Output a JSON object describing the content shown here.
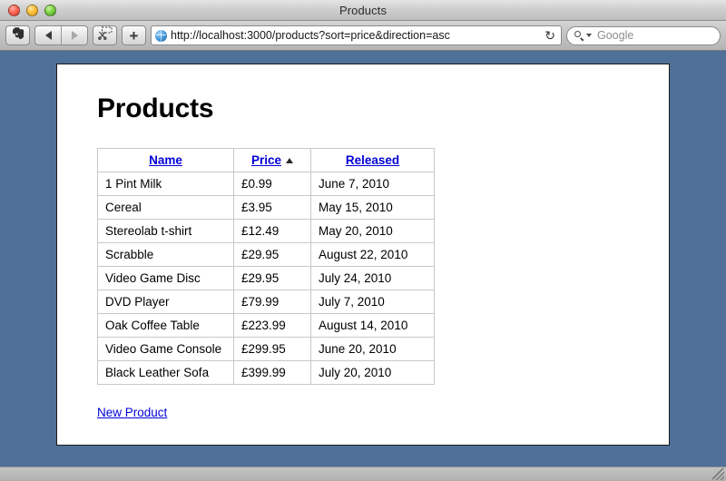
{
  "window": {
    "title": "Products",
    "controls": {
      "close": "close-button",
      "minimize": "minimize-button",
      "zoom": "zoom-button"
    }
  },
  "toolbar": {
    "clipper_icon": "evernote-elephant-icon",
    "back_icon": "back-arrow-icon",
    "forward_icon": "forward-arrow-icon",
    "clip_selection_icon": "scissors-clip-icon",
    "add_icon": "plus-icon",
    "url": "http://localhost:3000/products?sort=price&direction=asc",
    "favicon": "globe-favicon-icon",
    "reload_icon": "↻",
    "search": {
      "magnifier_icon": "magnifier-icon",
      "placeholder": "Google",
      "value": ""
    }
  },
  "page": {
    "heading": "Products",
    "table": {
      "columns": [
        {
          "label": "Name",
          "sorted": false
        },
        {
          "label": "Price",
          "sorted": true,
          "direction": "asc"
        },
        {
          "label": "Released",
          "sorted": false
        }
      ],
      "rows": [
        {
          "name": "1 Pint Milk",
          "price": "£0.99",
          "released": "June 7, 2010"
        },
        {
          "name": "Cereal",
          "price": "£3.95",
          "released": "May 15, 2010"
        },
        {
          "name": "Stereolab t-shirt",
          "price": "£12.49",
          "released": "May 20, 2010"
        },
        {
          "name": "Scrabble",
          "price": "£29.95",
          "released": "August 22, 2010"
        },
        {
          "name": "Video Game Disc",
          "price": "£29.95",
          "released": "July 24, 2010"
        },
        {
          "name": "DVD Player",
          "price": "£79.99",
          "released": "July 7, 2010"
        },
        {
          "name": "Oak Coffee Table",
          "price": "£223.99",
          "released": "August 14, 2010"
        },
        {
          "name": "Video Game Console",
          "price": "£299.95",
          "released": "June 20, 2010"
        },
        {
          "name": "Black Leather Sofa",
          "price": "£399.99",
          "released": "July 20, 2010"
        }
      ]
    },
    "new_product_link": "New Product"
  },
  "colors": {
    "page_background": "#4e7099",
    "link": "#0000d8",
    "table_border": "#c8c8c8",
    "card": "#ffffff"
  }
}
